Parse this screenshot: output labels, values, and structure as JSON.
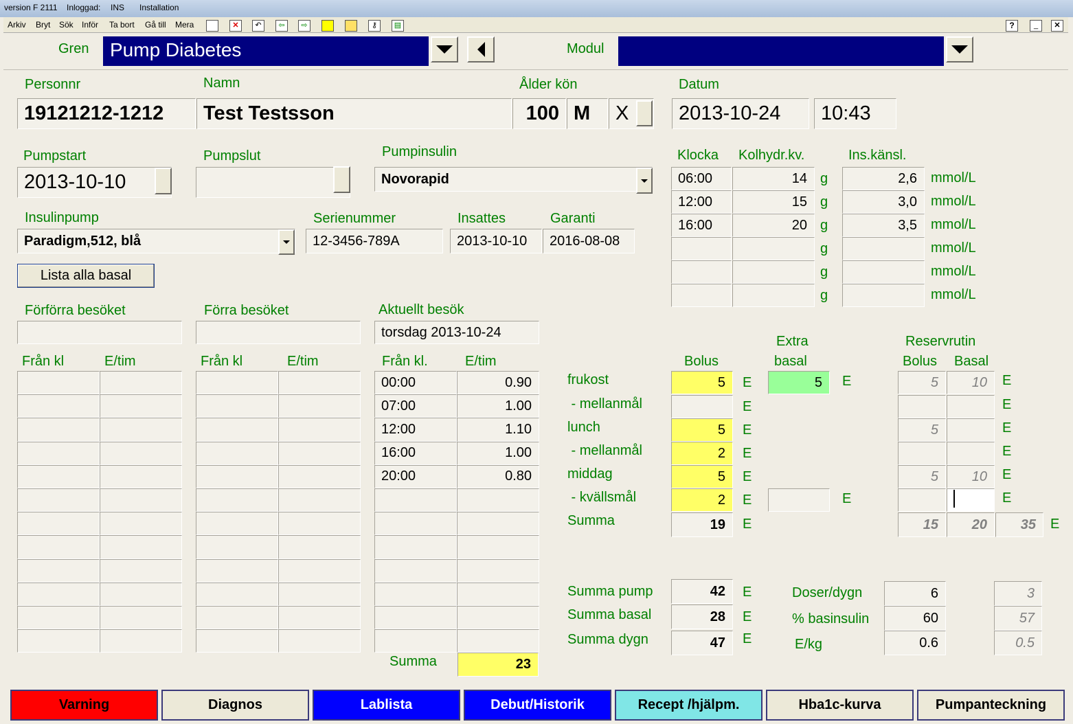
{
  "titlebar": {
    "version": "version F 2111",
    "inloggad_label": "Inloggad:",
    "inloggad_user": "INS",
    "installation": "Installation"
  },
  "menu": [
    "Arkiv",
    "Bryt",
    "Sök",
    "Inför",
    "Ta bort",
    "Gå till",
    "Mera"
  ],
  "help_label": "?",
  "header": {
    "gren_label": "Gren",
    "gren_value": "Pump Diabetes",
    "modul_label": "Modul",
    "modul_value": ""
  },
  "patient": {
    "personnr_label": "Personnr",
    "personnr": "19121212-1212",
    "namn_label": "Namn",
    "namn": "Test Testsson",
    "alder_label": "Ålder kön",
    "alder": "100",
    "kon": "M",
    "x": "X",
    "datum_label": "Datum",
    "datum": "2013-10-24",
    "tid": "10:43"
  },
  "pump": {
    "pumpstart_label": "Pumpstart",
    "pumpstart": "2013-10-10",
    "pumpslut_label": "Pumpslut",
    "pumpslut": "",
    "pumpinsulin_label": "Pumpinsulin",
    "pumpinsulin": "Novorapid",
    "insulinpump_label": "Insulinpump",
    "insulinpump": "Paradigm,512, blå",
    "serienummer_label": "Serienummer",
    "serienummer": "12-3456-789A",
    "insattes_label": "Insattes",
    "insattes": "2013-10-10",
    "garanti_label": "Garanti",
    "garanti": "2016-08-08",
    "lista_button": "Lista alla basal"
  },
  "kolhydrat": {
    "klocka_label": "Klocka",
    "kolhydr_label": "Kolhydr.kv.",
    "ins_label": "Ins.känsl.",
    "g_unit": "g",
    "mmol_unit": "mmol/L",
    "rows": [
      {
        "klocka": "06:00",
        "kh": "14",
        "ins": "2,6"
      },
      {
        "klocka": "12:00",
        "kh": "15",
        "ins": "3,0"
      },
      {
        "klocka": "16:00",
        "kh": "20",
        "ins": "3,5"
      },
      {
        "klocka": "",
        "kh": "",
        "ins": ""
      },
      {
        "klocka": "",
        "kh": "",
        "ins": ""
      },
      {
        "klocka": "",
        "kh": "",
        "ins": ""
      }
    ]
  },
  "visits": {
    "forforra_label": "Förförra besöket",
    "forforra_date": "",
    "forra_label": "Förra besöket",
    "forra_date": "",
    "aktuellt_label": "Aktuellt besök",
    "aktuellt_date": "torsdag 2013-10-24",
    "fran_kl": "Från kl",
    "fran_kl_dot": "Från kl.",
    "e_tim": "E/tim",
    "aktuellt_rows": [
      {
        "fran": "00:00",
        "etim": "0.90"
      },
      {
        "fran": "07:00",
        "etim": "1.00"
      },
      {
        "fran": "12:00",
        "etim": "1.10"
      },
      {
        "fran": "16:00",
        "etim": "1.00"
      },
      {
        "fran": "20:00",
        "etim": "0.80"
      },
      {
        "fran": "",
        "etim": ""
      },
      {
        "fran": "",
        "etim": ""
      },
      {
        "fran": "",
        "etim": ""
      },
      {
        "fran": "",
        "etim": ""
      },
      {
        "fran": "",
        "etim": ""
      },
      {
        "fran": "",
        "etim": ""
      },
      {
        "fran": "",
        "etim": ""
      }
    ],
    "summa_label": "Summa",
    "summa": "23"
  },
  "bolus": {
    "bolus_label": "Bolus",
    "extra_label": "Extra",
    "basal_label": "basal",
    "reserv_label": "Reservrutin",
    "reserv_bolus_label": "Bolus",
    "reserv_basal_label": "Basal",
    "e_unit": "E",
    "rows": [
      {
        "label": "frukost",
        "bolus": "5",
        "extra": "5",
        "rbolus": "5",
        "rbasal": "10"
      },
      {
        "label": " - mellanmål",
        "bolus": "",
        "extra": null,
        "rbolus": "",
        "rbasal": ""
      },
      {
        "label": "lunch",
        "bolus": "5",
        "extra": null,
        "rbolus": "5",
        "rbasal": ""
      },
      {
        "label": " - mellanmål",
        "bolus": "2",
        "extra": null,
        "rbolus": "",
        "rbasal": ""
      },
      {
        "label": "middag",
        "bolus": "5",
        "extra": null,
        "rbolus": "5",
        "rbasal": "10"
      },
      {
        "label": " - kvällsmål",
        "bolus": "2",
        "extra": "",
        "rbolus": "",
        "rbasal": ""
      }
    ],
    "summa_label": "Summa",
    "summa": "19",
    "reserv_sum_bolus": "15",
    "reserv_sum_basal": "20",
    "reserv_sum_total": "35"
  },
  "totals": {
    "summa_pump_label": "Summa pump",
    "summa_pump": "42",
    "summa_basal_label": "Summa basal",
    "summa_basal": "28",
    "summa_dygn_label": "Summa dygn",
    "summa_dygn": "47",
    "doser_label": "Doser/dygn",
    "doser": "6",
    "doser_r": "3",
    "basinsulin_label": "% basinsulin",
    "basinsulin": "60",
    "basinsulin_r": "57",
    "ekg_label": "E/kg",
    "ekg": "0.6",
    "ekg_r": "0.5"
  },
  "bottom_buttons": [
    {
      "label": "Varning",
      "color": "#ff0000",
      "text": "#000000"
    },
    {
      "label": "Diagnos",
      "color": "#ece9d8",
      "text": "#000000"
    },
    {
      "label": "Lablista",
      "color": "#0000ff",
      "text": "#ffffff"
    },
    {
      "label": "Debut/Historik",
      "color": "#0000ff",
      "text": "#ffffff"
    },
    {
      "label": "Recept /hjälpm.",
      "color": "#80e6e6",
      "text": "#000000"
    },
    {
      "label": "Hba1c-kurva",
      "color": "#ece9d8",
      "text": "#000000"
    },
    {
      "label": "Pumpanteckning",
      "color": "#ece9d8",
      "text": "#000000"
    }
  ]
}
